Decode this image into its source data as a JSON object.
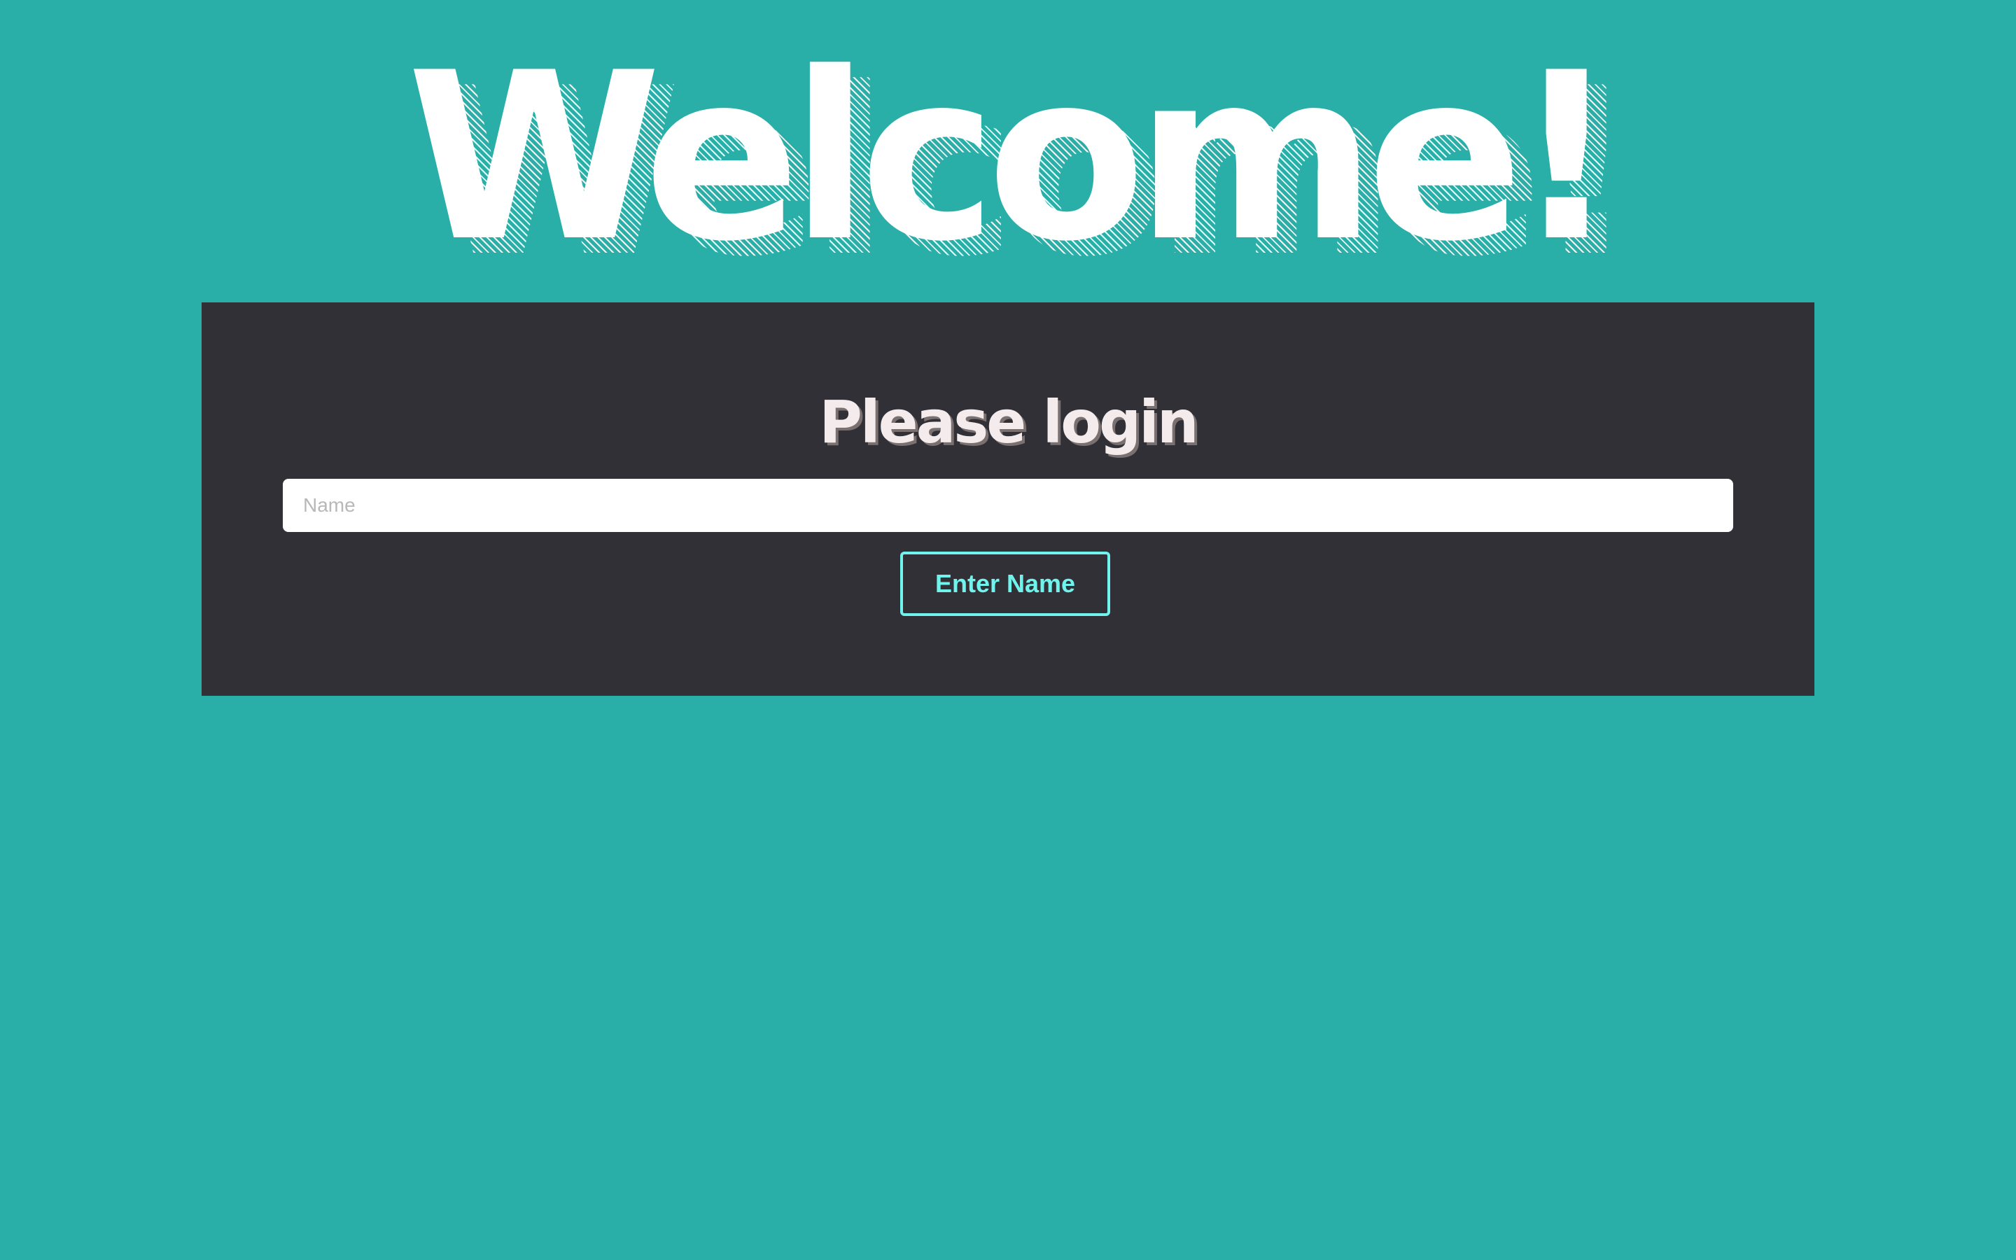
{
  "header": {
    "title": "Welcome!"
  },
  "login_panel": {
    "title": "Please login",
    "name_input": {
      "value": "",
      "placeholder": "Name"
    },
    "submit_label": "Enter Name"
  },
  "colors": {
    "background": "#2aafa8",
    "panel": "#303036",
    "accent": "#6ff3ec",
    "heading": "#ffffff"
  }
}
